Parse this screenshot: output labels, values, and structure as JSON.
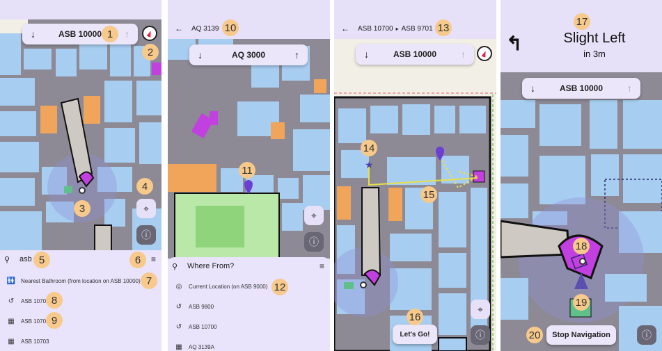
{
  "colors": {
    "room": "#a7cdf0",
    "corridor": "#8d8a95",
    "accent": "#c23fe0",
    "badge": "#f7c98b",
    "sheet": "#e9e3fb",
    "park": "#b9e8a8",
    "orange": "#f0a55a"
  },
  "screen1": {
    "floor_pill": {
      "down": "↓",
      "label": "ASB 10000",
      "up": "↑"
    },
    "badges": [
      "1",
      "2",
      "3",
      "4",
      "5",
      "6",
      "7",
      "8",
      "9"
    ],
    "search": {
      "icon": "search-icon",
      "query": "asb"
    },
    "results": [
      {
        "icon": "restroom-icon",
        "label": "Nearest Bathroom (from location on ASB 10000)"
      },
      {
        "icon": "history-icon",
        "label": "ASB 10700"
      },
      {
        "icon": "history-icon",
        "label": "ASB 10702"
      },
      {
        "icon": "map-icon",
        "label": "ASB 10703"
      }
    ]
  },
  "screen2": {
    "header": {
      "back": "←",
      "title": "AQ 3139"
    },
    "floor_pill": {
      "down": "↓",
      "label": "AQ 3000",
      "up": "↑"
    },
    "badges": [
      "10",
      "11",
      "12"
    ],
    "search": {
      "placeholder": "Where From?"
    },
    "results": [
      {
        "icon": "my-location-icon",
        "label": "Current Location (on ASB 9000)"
      },
      {
        "icon": "history-icon",
        "label": "ASB 9800"
      },
      {
        "icon": "history-icon",
        "label": "ASB 10700"
      },
      {
        "icon": "map-icon",
        "label": "AQ 3139A"
      }
    ]
  },
  "screen3": {
    "header": {
      "back": "←",
      "from": "ASB 10700",
      "sep": "▸",
      "to": "ASB 9701"
    },
    "floor_pill": {
      "down": "↓",
      "label": "ASB 10000",
      "up": "↑"
    },
    "badges": [
      "13",
      "14",
      "15",
      "16"
    ],
    "go_button": "Let's Go!"
  },
  "screen4": {
    "direction": {
      "text": "Slight Left",
      "distance": "in 3m"
    },
    "floor_pill": {
      "down": "↓",
      "label": "ASB 10000",
      "up": "↑"
    },
    "badges": [
      "17",
      "18",
      "19",
      "20"
    ],
    "stop_button": "Stop Navigation"
  }
}
